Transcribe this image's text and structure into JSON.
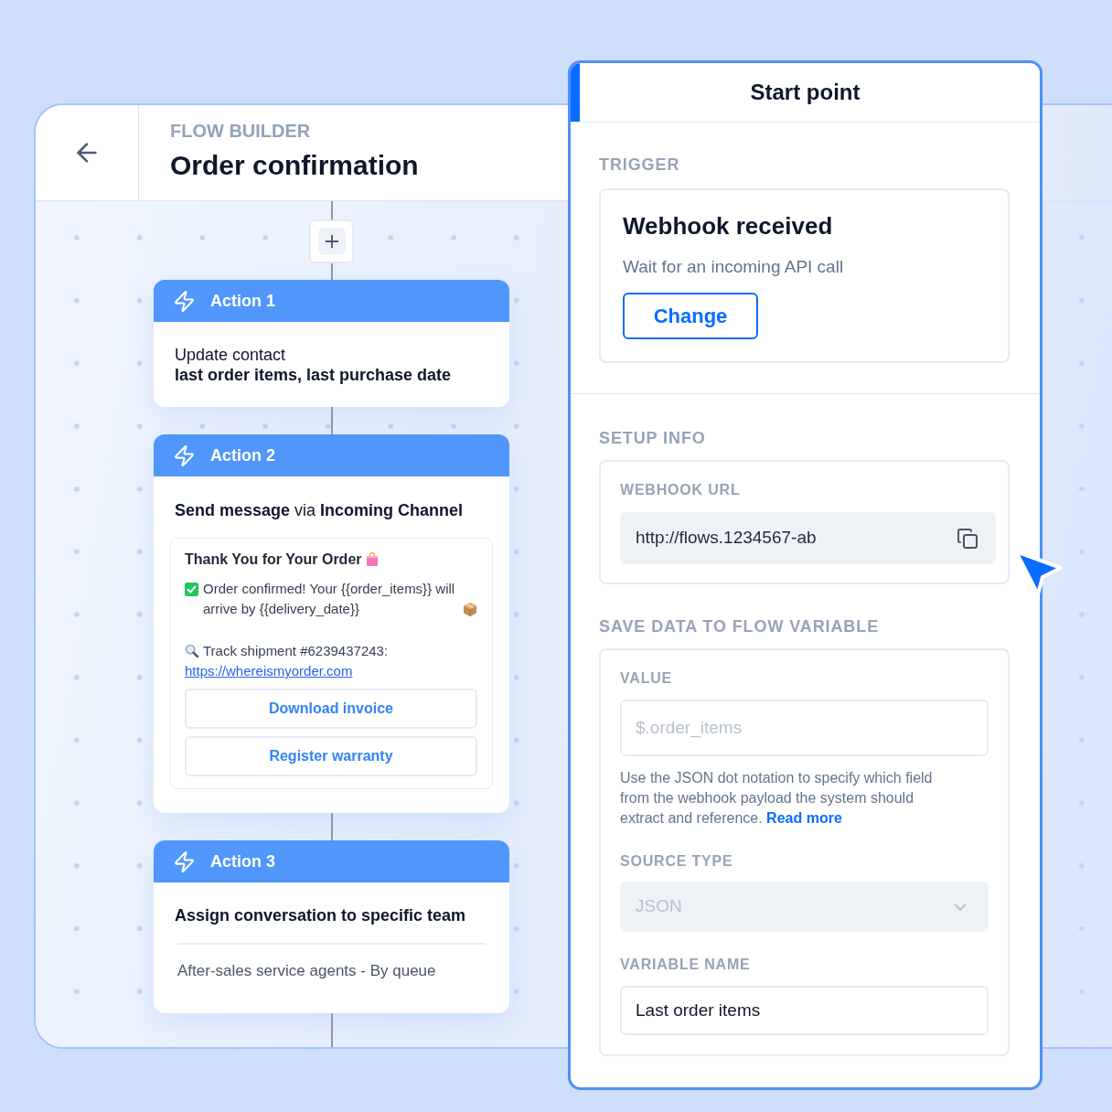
{
  "header": {
    "eyebrow": "FLOW BUILDER",
    "title": "Order confirmation"
  },
  "actions": [
    {
      "kind": "update_contact",
      "label": "Action 1",
      "text": "Update contact",
      "detail": "last order items, last purchase date"
    },
    {
      "kind": "send_message",
      "label": "Action 2",
      "text": "**Send message** via **Incoming Channel**",
      "message": {
        "title": "Thank You for Your Order",
        "body": "Order confirmed! Your {{order_items}} will arrive by {{delivery_date}}",
        "tracking": "Track shipment #6239437243:",
        "link": "https://whereismyorder.com",
        "buttons": [
          "Download invoice",
          "Register warranty"
        ]
      }
    },
    {
      "kind": "assign_team",
      "label": "Action 3",
      "text": "Assign conversation to specific team",
      "detail": "After-sales service agents - By queue"
    }
  ],
  "panel": {
    "title": "Start point",
    "trigger": {
      "heading": "TRIGGER",
      "title": "Webhook received",
      "description": "Wait for an incoming API call",
      "button": "Change"
    },
    "setup_info": {
      "heading": "SETUP INFO",
      "label": "WEBHOOK URL",
      "url": "http://flows.1234567-ab"
    },
    "save_data": {
      "heading": "SAVE DATA TO FLOW VARIABLE",
      "fields": [
        {
          "kind": "input",
          "label": "VALUE",
          "placeholder": "$.order_items",
          "help": "Use the JSON dot notation to specify which field from the webhook payload the system should extract and reference.",
          "help_link": "Read more"
        },
        {
          "kind": "select",
          "label": "SOURCE TYPE",
          "value": "JSON",
          "disabled": true
        },
        {
          "kind": "input",
          "label": "VARIABLE NAME",
          "value": "Last order items"
        }
      ]
    }
  }
}
